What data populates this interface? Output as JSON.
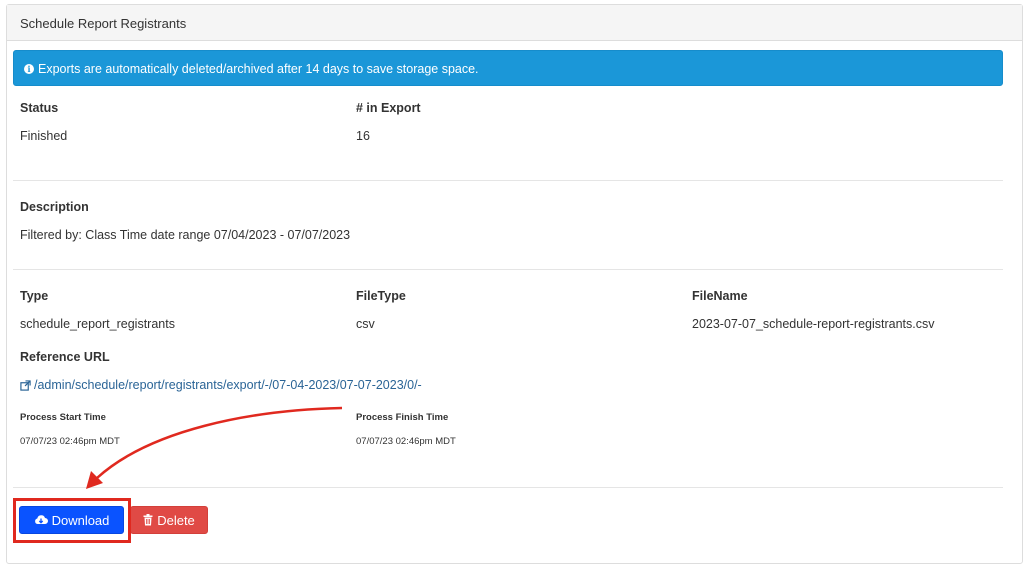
{
  "panel": {
    "title": "Schedule Report Registrants"
  },
  "alert": {
    "text": "Exports are automatically deleted/archived after 14 days to save storage space."
  },
  "status": {
    "label": "Status",
    "value": "Finished"
  },
  "count": {
    "label": "# in Export",
    "value": "16"
  },
  "description": {
    "label": "Description",
    "value": "Filtered by: Class Time date range 07/04/2023 - 07/07/2023"
  },
  "type": {
    "label": "Type",
    "value": "schedule_report_registrants"
  },
  "filetype": {
    "label": "FileType",
    "value": "csv"
  },
  "filename": {
    "label": "FileName",
    "value": "2023-07-07_schedule-report-registrants.csv"
  },
  "reference": {
    "label": "Reference URL",
    "url": "/admin/schedule/report/registrants/export/-/07-04-2023/07-07-2023/0/-"
  },
  "process_start": {
    "label": "Process Start Time",
    "value": "07/07/23 02:46pm MDT"
  },
  "process_finish": {
    "label": "Process Finish Time",
    "value": "07/07/23 02:46pm MDT"
  },
  "buttons": {
    "download": "Download",
    "delete": "Delete"
  },
  "colors": {
    "alert_bg": "#1b97d8",
    "download_bg": "#0a53ff",
    "delete_bg": "#e04a45",
    "annotation": "#e0291f"
  },
  "icons": {
    "alert": "info-circle-icon",
    "reference": "external-link-icon",
    "download": "cloud-download-icon",
    "delete": "trash-icon"
  }
}
